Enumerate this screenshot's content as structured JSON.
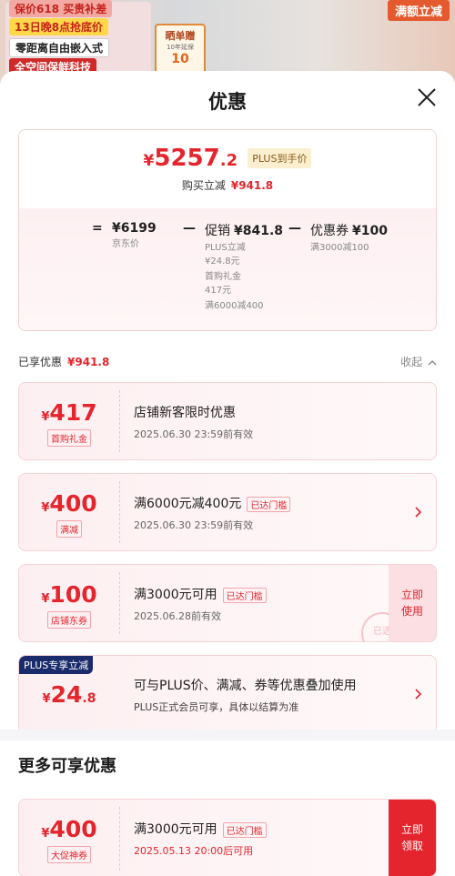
{
  "background": {
    "promo_line1": "保价618 买贵补差",
    "promo_line2": "13日晚8点抢底价",
    "promo_line3": "零距离自由嵌入式",
    "promo_line4": "全空间保鲜科技",
    "gift_line1": "晒单赠",
    "gift_line2": "10年延保",
    "gift_line3": "10",
    "right_tag": "满额立减"
  },
  "sheet": {
    "title": "优惠",
    "final_price": {
      "currency": "¥",
      "integer": "5257",
      "decimal": ".2"
    },
    "plus_tag": "PLUS到手价",
    "buy_reduce_label": "购买立减",
    "buy_reduce_amount": "¥941.8",
    "breakdown": {
      "equals": "=",
      "jd_price": "¥6199",
      "jd_price_label": "京东价",
      "minus1": "—",
      "promo_name": "促销",
      "promo_amount": "¥841.8",
      "promo_sub1": "PLUS立减",
      "promo_sub2": "¥24.8元",
      "promo_sub3": "首购礼金",
      "promo_sub4": "417元",
      "promo_sub5": "满6000减400",
      "minus2": "—",
      "coupon_name": "优惠券",
      "coupon_amount": "¥100",
      "coupon_sub": "满3000减100"
    },
    "enjoyed_label": "已享优惠",
    "enjoyed_amount": "¥941.8",
    "collapse_label": "收起"
  },
  "cards": [
    {
      "currency": "¥",
      "integer": "417",
      "decimal": "",
      "kind": "首购礼金",
      "title": "店铺新客限时优惠",
      "reach": "",
      "date": "2025.06.30 23:59前有效"
    },
    {
      "currency": "¥",
      "integer": "400",
      "decimal": "",
      "kind": "满减",
      "title": "满6000元减400元",
      "reach": "已达门槛",
      "date": "2025.06.30 23:59前有效"
    },
    {
      "currency": "¥",
      "integer": "100",
      "decimal": "",
      "kind": "店铺东券",
      "title": "满3000元可用",
      "reach": "已达门槛",
      "date": "2025.06.28前有效",
      "button": "立即使用",
      "stamp": "已选"
    },
    {
      "flag": "PLUS专享立减",
      "currency": "¥",
      "integer": "24",
      "decimal": ".8",
      "title": "可与PLUS价、满减、券等优惠叠加使用",
      "desc": "PLUS正式会员可享，具体以结算为准"
    }
  ],
  "more": {
    "title": "更多可享优惠",
    "card": {
      "currency": "¥",
      "integer": "400",
      "kind": "大促神券",
      "title": "满3000元可用",
      "reach": "已达门槛",
      "date": "2025.05.13 20:00后可用",
      "button": "立即领取"
    }
  },
  "colors": {
    "accent": "#e4252d",
    "plus_navy": "#1a2b6b"
  },
  "icons": {
    "close": "close-icon",
    "collapse": "chevron-up-icon",
    "arrow": "chevron-right-icon"
  }
}
